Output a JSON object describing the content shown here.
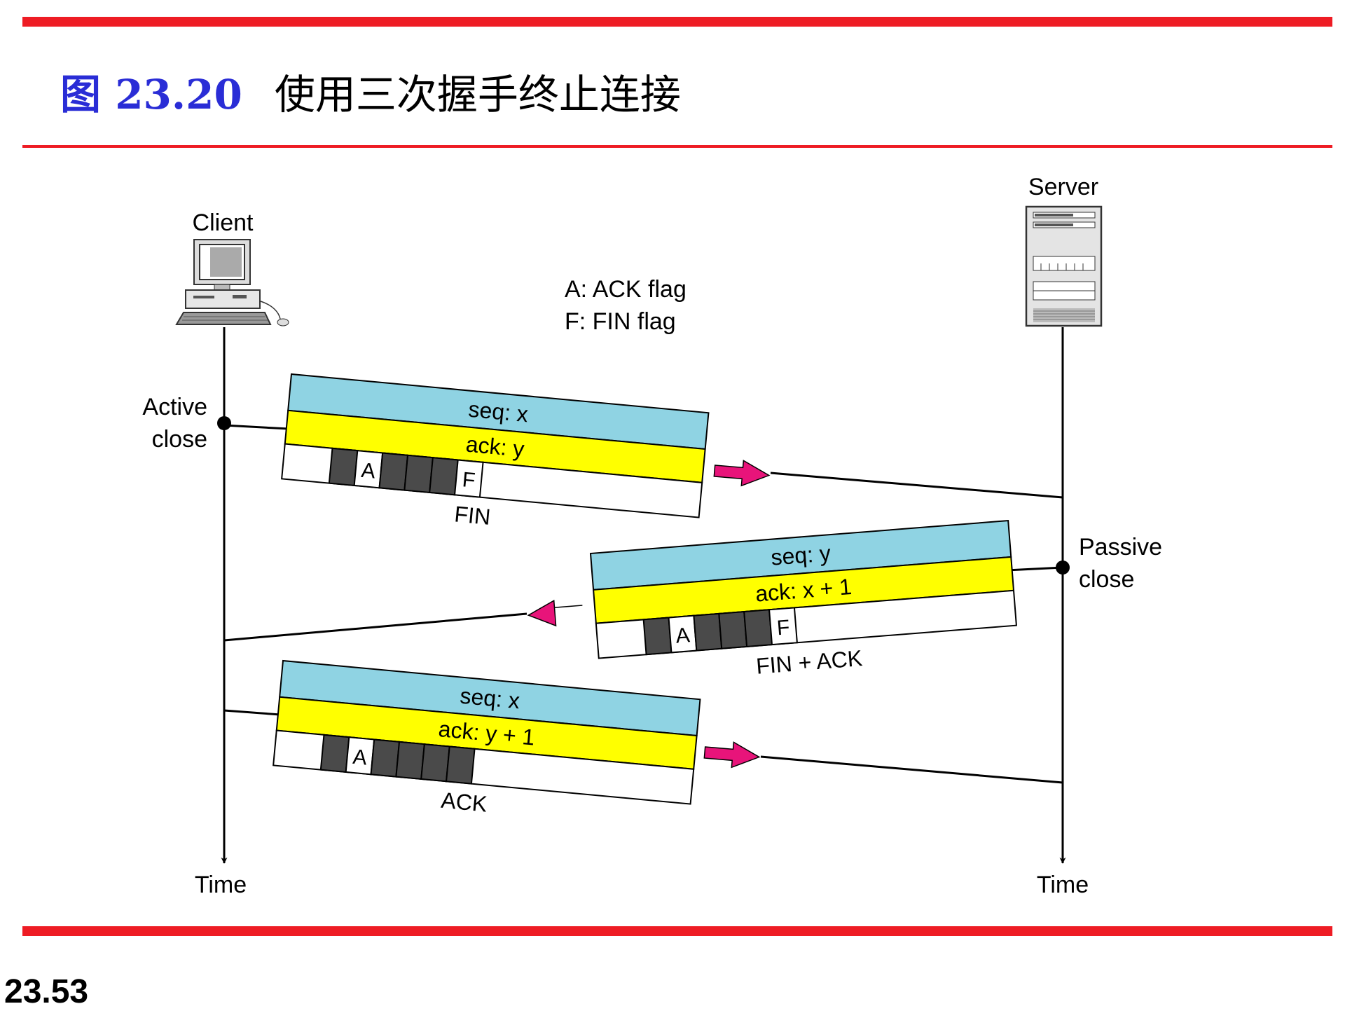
{
  "slide": {
    "figure_label": "图 23.20",
    "caption": "使用三次握手终止连接",
    "page_number": "23.53"
  },
  "hosts": {
    "client_label": "Client",
    "server_label": "Server",
    "client_time": "Time",
    "server_time": "Time"
  },
  "legend": {
    "line1": "A: ACK flag",
    "line2": "F: FIN flag"
  },
  "events": {
    "active_close_line1": "Active",
    "active_close_line2": "close",
    "passive_close_line1": "Passive",
    "passive_close_line2": "close"
  },
  "segments": [
    {
      "direction": "client-to-server",
      "seq": "seq: x",
      "ack": "ack: y",
      "flags": [
        "",
        "",
        "A",
        "",
        "",
        "",
        "F"
      ],
      "name": "FIN"
    },
    {
      "direction": "server-to-client",
      "seq": "seq: y",
      "ack": "ack: x + 1",
      "flags": [
        "",
        "",
        "A",
        "",
        "",
        "",
        "F"
      ],
      "name": "FIN + ACK"
    },
    {
      "direction": "client-to-server",
      "seq": "seq: x",
      "ack": "ack: y + 1",
      "flags": [
        "",
        "",
        "A",
        "",
        "",
        "",
        ""
      ],
      "name": "ACK"
    }
  ],
  "colors": {
    "rule": "#ee1c24",
    "figure_label": "#2a2dd6",
    "seq_band": "#8fd3e3",
    "ack_band": "#ffff00",
    "flag_cell": "#4a4a4a",
    "arrow": "#e8147a"
  }
}
